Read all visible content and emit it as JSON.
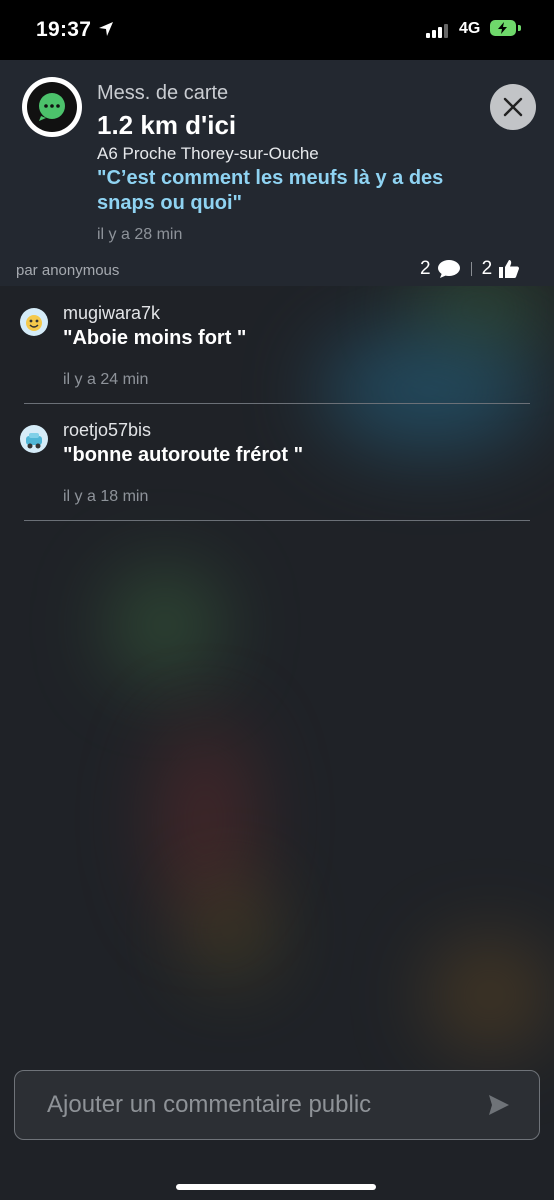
{
  "status_bar": {
    "time": "19:37",
    "network": "4G"
  },
  "header": {
    "type_label": "Mess. de carte",
    "distance": "1.2 km d'ici",
    "road": "A6 Proche Thorey-sur-Ouche",
    "message": "\"C’est comment les meufs là y a des snaps ou quoi\"",
    "time_ago": "il y a 28 min",
    "author": "par anonymous",
    "comments_count": "2",
    "likes_count": "2"
  },
  "comments": [
    {
      "user": "mugiwara7k",
      "text": "\"Aboie moins fort \"",
      "time_ago": "il y a 24 min"
    },
    {
      "user": "roetjo57bis",
      "text": "\"bonne autoroute frérot \"",
      "time_ago": "il y a 18 min"
    }
  ],
  "input": {
    "placeholder": "Ajouter un commentaire public"
  },
  "colors": {
    "accent": "#8fd3f2",
    "brand_green": "#4cc26b",
    "battery": "#6fd86b"
  }
}
